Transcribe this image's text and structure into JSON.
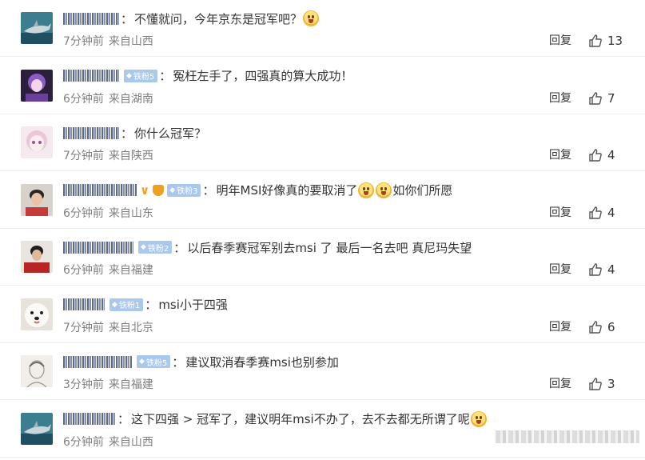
{
  "comments": [
    {
      "name_width": 70,
      "badge": "",
      "crown": false,
      "vmark": false,
      "text": "不懂就问，今年京东是冠军吧？",
      "emoji_after": 1,
      "time": "7分钟前",
      "location": "来自山西",
      "reply_label": "回复",
      "likes": "13",
      "avatar": "shark"
    },
    {
      "name_width": 70,
      "badge": "铁粉5",
      "crown": false,
      "vmark": false,
      "text": "冤枉左手了，四强真的算大成功！",
      "emoji_after": 0,
      "time": "6分钟前",
      "location": "来自湖南",
      "reply_label": "回复",
      "likes": "7",
      "avatar": "purple"
    },
    {
      "name_width": 70,
      "badge": "",
      "crown": false,
      "vmark": false,
      "text": "你什么冠军？",
      "emoji_after": 0,
      "time": "7分钟前",
      "location": "来自陕西",
      "reply_label": "回复",
      "likes": "4",
      "avatar": "anime"
    },
    {
      "name_width": 92,
      "badge": "铁粉3",
      "crown": true,
      "vmark": true,
      "text": "明年MSI好像真的要取消了",
      "text2": "如你们所愿",
      "emoji_after": 2,
      "time": "6分钟前",
      "location": "来自山东",
      "reply_label": "回复",
      "likes": "4",
      "avatar": "man"
    },
    {
      "name_width": 88,
      "badge": "铁粉2",
      "crown": false,
      "vmark": false,
      "text": "以后春季赛冠军别去msi 了 最后一名去吧 真尼玛失望",
      "emoji_after": 0,
      "time": "6分钟前",
      "location": "来自福建",
      "reply_label": "回复",
      "likes": "4",
      "avatar": "red"
    },
    {
      "name_width": 52,
      "badge": "铁粉1",
      "crown": false,
      "vmark": false,
      "text": "msi小于四强",
      "emoji_after": 0,
      "time": "7分钟前",
      "location": "来自北京",
      "reply_label": "回复",
      "likes": "6",
      "avatar": "dog"
    },
    {
      "name_width": 86,
      "badge": "铁粉5",
      "crown": false,
      "vmark": false,
      "text": "建议取消春季赛msi也别参加",
      "emoji_after": 0,
      "time": "3分钟前",
      "location": "来自福建",
      "reply_label": "回复",
      "likes": "3",
      "avatar": "sketch"
    },
    {
      "name_width": 66,
      "badge": "",
      "crown": false,
      "vmark": false,
      "text": "这下四强 > 冠军了，建议明年msi不办了，去不去都无所谓了呢",
      "emoji_after": 1,
      "time": "6分钟前",
      "location": "来自山西",
      "reply_label": "",
      "likes": "",
      "avatar": "shark"
    }
  ],
  "badge_gem": "◆",
  "colors": {
    "badge_bg": "#a9c8ec",
    "meta": "#808080",
    "text": "#333333",
    "divider": "#eeeeee"
  }
}
